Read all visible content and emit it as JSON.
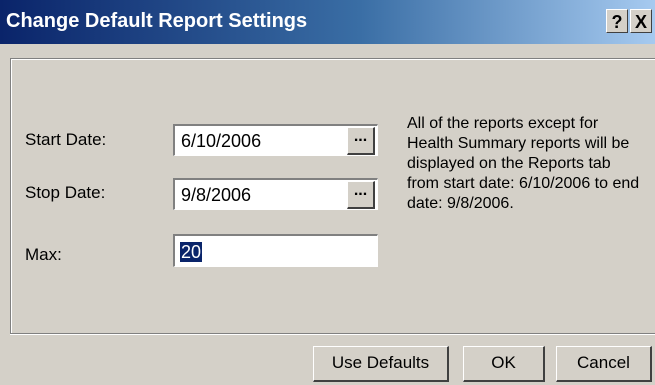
{
  "window": {
    "title": "Change Default Report Settings",
    "help_label": "?",
    "close_label": "X"
  },
  "form": {
    "start_date_label": "Start Date:",
    "start_date_value": "6/10/2006",
    "stop_date_label": "Stop Date:",
    "stop_date_value": "9/8/2006",
    "max_label": "Max:",
    "max_value": "20",
    "picker_label": "..."
  },
  "info": {
    "text": "All of the reports except for Health Summary reports will be displayed on the Reports tab from start date: 6/10/2006 to end date: 9/8/2006."
  },
  "buttons": {
    "use_defaults": "Use Defaults",
    "ok": "OK",
    "cancel": "Cancel"
  }
}
